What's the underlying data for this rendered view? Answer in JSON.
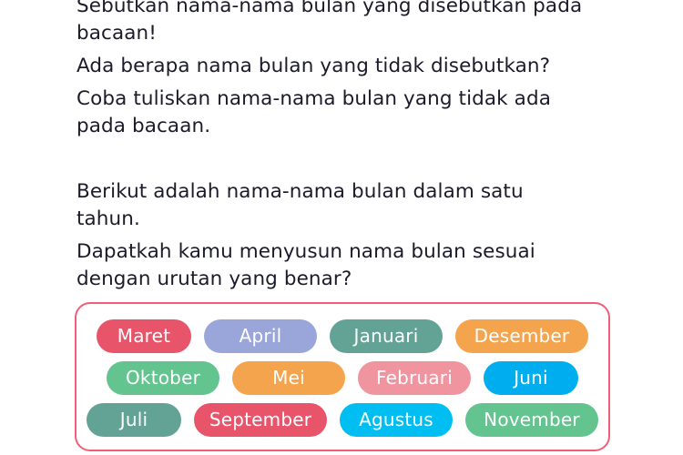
{
  "questions": {
    "lines": [
      "Sebutkan nama-nama bulan yang disebutkan pada",
      "bacaan!",
      "Ada berapa nama bulan yang tidak disebutkan?",
      "Coba tuliskan nama-nama bulan yang tidak ada",
      "pada bacaan."
    ],
    "q1_line1": "Sebutkan nama-nama bulan yang disebutkan pada",
    "q1_line2": "bacaan!",
    "q2": "Ada berapa nama bulan yang tidak disebutkan?",
    "q3_line1": "Coba tuliskan nama-nama bulan yang tidak ada",
    "q3_line2": "pada bacaan."
  },
  "intro": {
    "line1": "Berikut adalah nama-nama bulan dalam satu",
    "line2": "tahun.",
    "line3": "Dapatkah kamu menyusun nama bulan sesuai",
    "line4": "dengan urutan yang benar?"
  },
  "months_panel": {
    "border_color": "#ef5f78",
    "rows": [
      [
        {
          "label": "Maret",
          "color": "#e8556b",
          "size": "w-sm"
        },
        {
          "label": "April",
          "color": "#9aa5da",
          "size": "w-md"
        },
        {
          "label": "Januari",
          "color": "#63a396",
          "size": "w-md"
        },
        {
          "label": "Desember",
          "color": "#f5a44e",
          "size": "w-lg"
        }
      ],
      [
        {
          "label": "Oktober",
          "color": "#63c48f",
          "size": "w-md"
        },
        {
          "label": "Mei",
          "color": "#f5a44e",
          "size": "w-md"
        },
        {
          "label": "Februari",
          "color": "#f094a0",
          "size": "w-md"
        },
        {
          "label": "Juni",
          "color": "#00aeef",
          "size": "w-sm"
        }
      ],
      [
        {
          "label": "Juli",
          "color": "#63a396",
          "size": "w-sm"
        },
        {
          "label": "September",
          "color": "#e8556b",
          "size": "w-lg"
        },
        {
          "label": "Agustus",
          "color": "#00bdf2",
          "size": "w-md"
        },
        {
          "label": "November",
          "color": "#63c48f",
          "size": "w-lg"
        }
      ]
    ]
  }
}
